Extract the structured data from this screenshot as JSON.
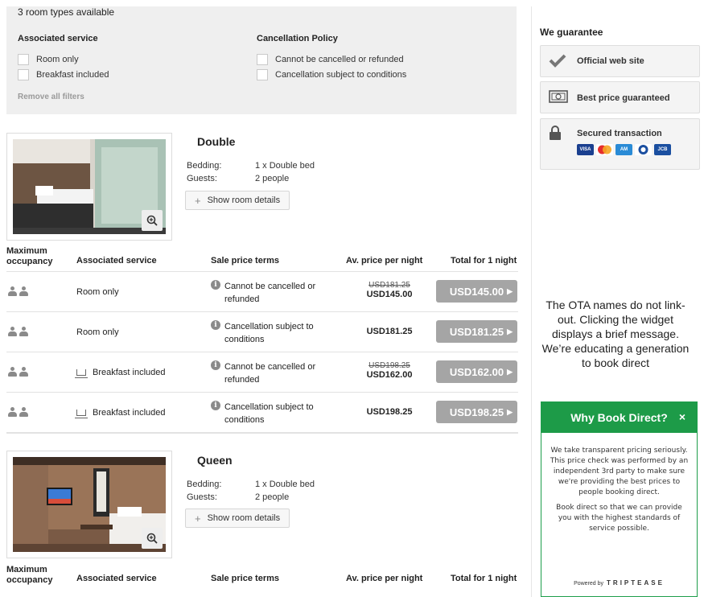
{
  "filters": {
    "rooms_available": "3 room types available",
    "associated_service": {
      "title": "Associated service",
      "options": [
        "Room only",
        "Breakfast included"
      ]
    },
    "cancellation_policy": {
      "title": "Cancellation Policy",
      "options": [
        "Cannot be cancelled or refunded",
        "Cancellation subject to conditions"
      ]
    },
    "remove_all": "Remove all filters"
  },
  "table_headers": {
    "occupancy": "Maximum occupancy",
    "service": "Associated service",
    "terms": "Sale price terms",
    "avg_price": "Av. price per night",
    "total": "Total for 1 night"
  },
  "rooms": [
    {
      "name": "Double",
      "bedding_label": "Bedding:",
      "bedding": "1 x Double bed",
      "guests_label": "Guests:",
      "guests": "2 people",
      "details_button": "Show room details",
      "rates": [
        {
          "service": "Room only",
          "breakfast_icon": false,
          "terms": "Cannot be cancelled or refunded",
          "old_price": "USD181.25",
          "avg_price": "USD145.00",
          "total": "USD145.00"
        },
        {
          "service": "Room only",
          "breakfast_icon": false,
          "terms": "Cancellation subject to conditions",
          "old_price": "",
          "avg_price": "USD181.25",
          "total": "USD181.25"
        },
        {
          "service": "Breakfast included",
          "breakfast_icon": true,
          "terms": "Cannot be cancelled or refunded",
          "old_price": "USD198.25",
          "avg_price": "USD162.00",
          "total": "USD162.00"
        },
        {
          "service": "Breakfast included",
          "breakfast_icon": true,
          "terms": "Cancellation subject to conditions",
          "old_price": "",
          "avg_price": "USD198.25",
          "total": "USD198.25"
        }
      ]
    },
    {
      "name": "Queen",
      "bedding_label": "Bedding:",
      "bedding": "1 x Double bed",
      "guests_label": "Guests:",
      "guests": "2 people",
      "details_button": "Show room details"
    }
  ],
  "guarantee": {
    "title": "We guarantee",
    "items": [
      "Official web site",
      "Best price guaranteed",
      "Secured transaction"
    ],
    "card_icons": [
      "visa-card-icon",
      "mastercard-icon",
      "amex-card-icon",
      "diners-card-icon",
      "jcb-card-icon"
    ]
  },
  "annotation": "The OTA names do not link-out. Clicking the widget displays a brief message. We’re educating a generation to book direct",
  "why_book_direct": {
    "title": "Why Book Direct?",
    "close": "×",
    "paragraph1": "We take transparent pricing seriously. This price check was performed by an independent 3rd party to make sure we're providing the best prices to people booking direct.",
    "paragraph2": "Book direct so that we can provide you with the highest standards of service possible.",
    "powered_by": "Powered by",
    "brand": "TRIPTEASE"
  },
  "colors": {
    "accent_green": "#1d9b48",
    "book_button_grey": "#a5a5a5",
    "filter_bg": "#efefef"
  }
}
